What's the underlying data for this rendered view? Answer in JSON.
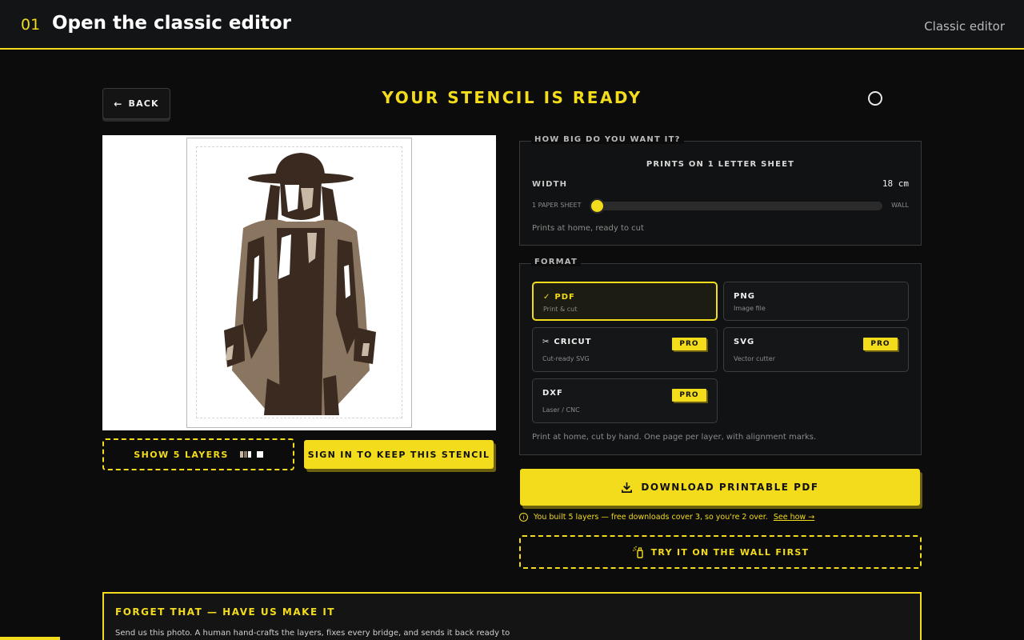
{
  "header": {
    "step": "01",
    "title": "Open the classic editor",
    "right_link": "Classic editor"
  },
  "stage": {
    "back_label": "BACK",
    "title": "YOUR STENCIL IS READY"
  },
  "preview": {
    "layers_button": "SHOW 5 LAYERS",
    "layer_colors": [
      "#8a7560",
      "#c9b8a5",
      "#ffffff"
    ],
    "signin_button": "SIGN IN TO KEEP THIS STENCIL"
  },
  "size": {
    "legend": "HOW BIG DO YOU WANT IT?",
    "prints_on": "PRINTS ON 1 LETTER SHEET",
    "width_label": "WIDTH",
    "width_value": "18 cm",
    "slider_min": "1 PAPER SHEET",
    "slider_max": "WALL",
    "slider_fraction": 0.0,
    "note": "Prints at home, ready to cut"
  },
  "format": {
    "legend": "FORMAT",
    "options": [
      {
        "name": "PDF",
        "sub": "Print & cut",
        "selected": true,
        "pro": false
      },
      {
        "name": "PNG",
        "sub": "Image file",
        "selected": false,
        "pro": false
      },
      {
        "name": "CRICUT",
        "sub": "Cut-ready SVG",
        "selected": false,
        "pro": true
      },
      {
        "name": "SVG",
        "sub": "Vector cutter",
        "selected": false,
        "pro": true
      },
      {
        "name": "DXF",
        "sub": "Laser / CNC",
        "selected": false,
        "pro": true
      }
    ],
    "pro_label": "PRO",
    "note": "Print at home, cut by hand. One page per layer, with alignment marks."
  },
  "download": {
    "label": "DOWNLOAD PRINTABLE PDF",
    "info": "You built 5 layers — free downloads cover 3, so you're 2 over.",
    "info_link": "See how →",
    "wall_button": "TRY IT ON THE WALL FIRST"
  },
  "make_card": {
    "title": "FORGET THAT — HAVE US MAKE IT",
    "desc": "Send us this photo. A human hand-crafts the layers, fixes every bridge, and sends it back ready to"
  },
  "colors": {
    "accent": "#f3dc1c",
    "background": "#0c0c0c",
    "stencil_dark": "#3a2a20",
    "stencil_mid": "#8a7560"
  }
}
